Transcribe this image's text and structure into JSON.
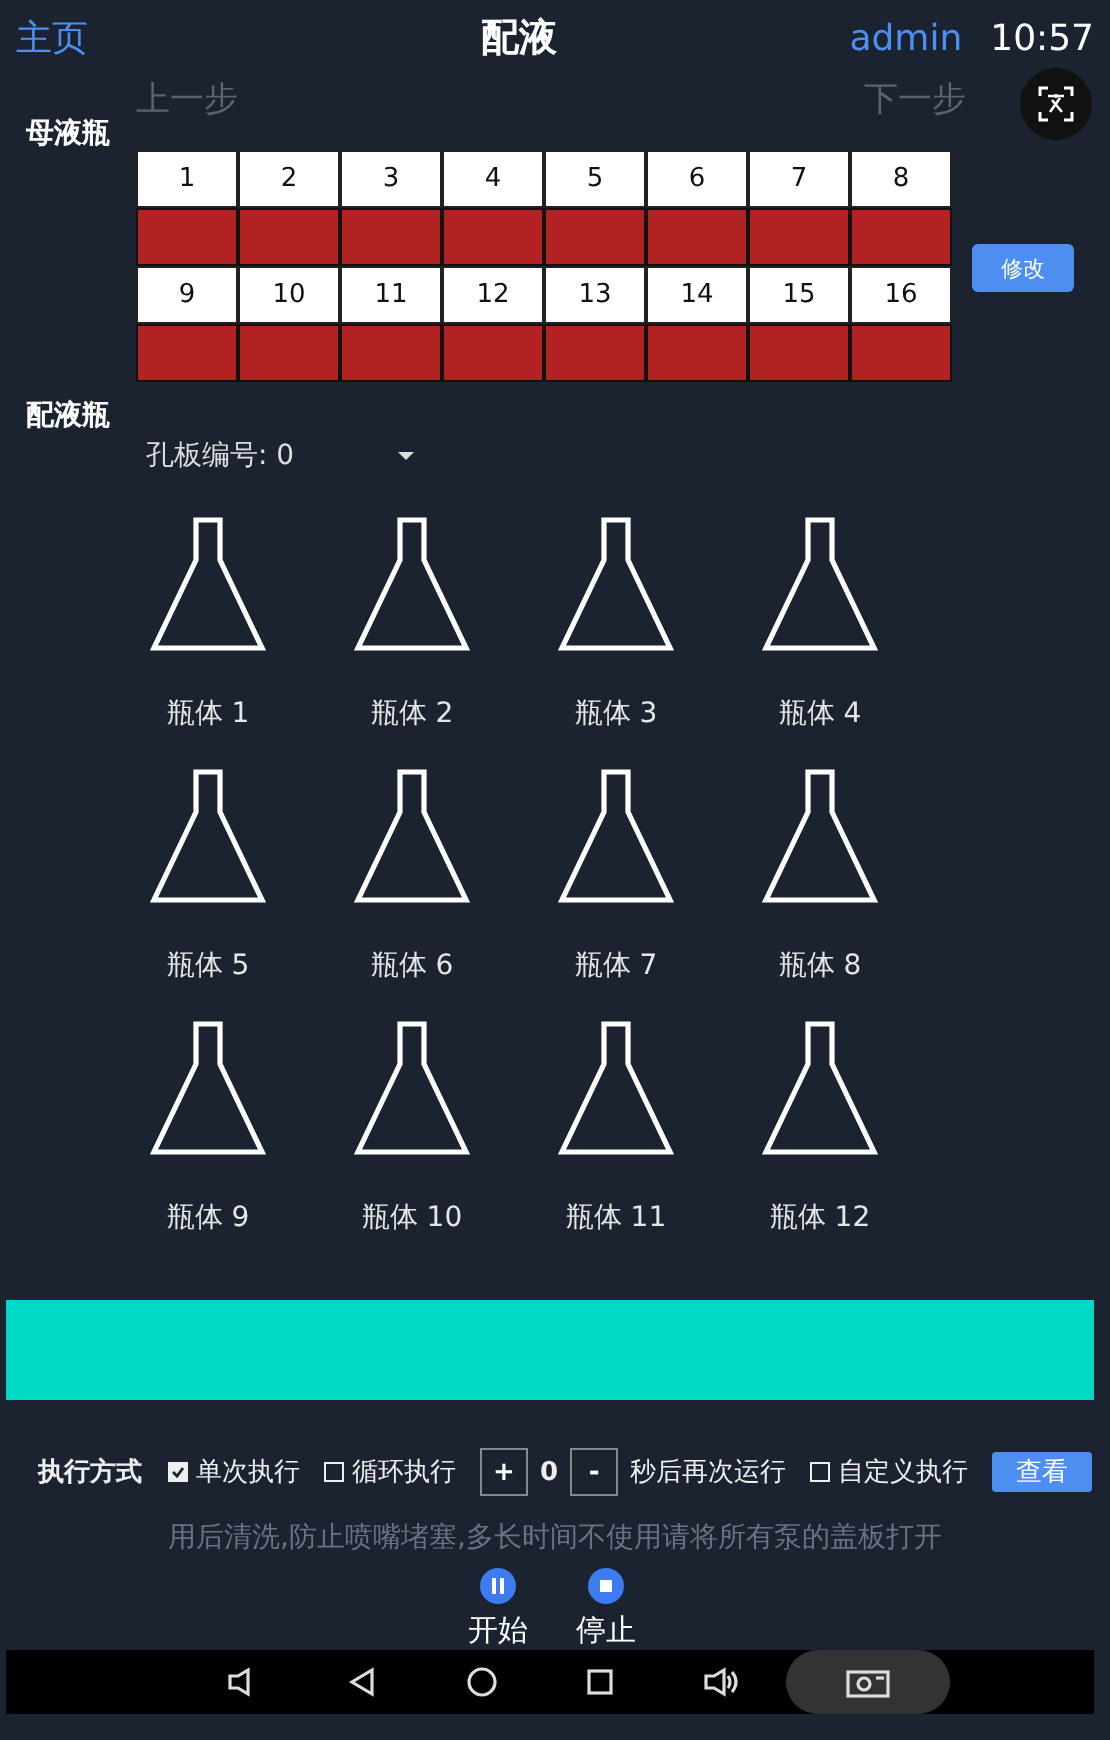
{
  "header": {
    "home": "主页",
    "title": "配液",
    "user": "admin",
    "time": "10:57"
  },
  "steps": {
    "prev": "上一步",
    "next": "下一步"
  },
  "stock": {
    "label": "母液瓶",
    "edit_button": "修改",
    "wells": [
      {
        "number": "1",
        "color": "#b22222"
      },
      {
        "number": "2",
        "color": "#b22222"
      },
      {
        "number": "3",
        "color": "#b22222"
      },
      {
        "number": "4",
        "color": "#b22222"
      },
      {
        "number": "5",
        "color": "#b22222"
      },
      {
        "number": "6",
        "color": "#b22222"
      },
      {
        "number": "7",
        "color": "#b22222"
      },
      {
        "number": "8",
        "color": "#b22222"
      },
      {
        "number": "9",
        "color": "#b22222"
      },
      {
        "number": "10",
        "color": "#b22222"
      },
      {
        "number": "11",
        "color": "#b22222"
      },
      {
        "number": "12",
        "color": "#b22222"
      },
      {
        "number": "13",
        "color": "#b22222"
      },
      {
        "number": "14",
        "color": "#b22222"
      },
      {
        "number": "15",
        "color": "#b22222"
      },
      {
        "number": "16",
        "color": "#b22222"
      }
    ]
  },
  "mixing": {
    "label": "配液瓶",
    "plate_select": "孔板编号: 0",
    "bottles": [
      "瓶体 1",
      "瓶体 2",
      "瓶体 3",
      "瓶体 4",
      "瓶体 5",
      "瓶体 6",
      "瓶体 7",
      "瓶体 8",
      "瓶体 9",
      "瓶体 10",
      "瓶体 11",
      "瓶体 12"
    ]
  },
  "progress": {
    "level": 1
  },
  "execution": {
    "label": "执行方式",
    "options": [
      {
        "label": "单次执行",
        "checked": true
      },
      {
        "label": "循环执行",
        "checked": false
      }
    ],
    "plus": "+",
    "interval": "0",
    "minus": "-",
    "interval_suffix": "秒后再次运行",
    "custom": {
      "label": "自定义执行",
      "checked": false
    },
    "view_button": "查看",
    "hint": "用后清洗,防止喷嘴堵塞,多长时间不使用请将所有泵的盖板打开",
    "start": "开始",
    "stop": "停止"
  }
}
